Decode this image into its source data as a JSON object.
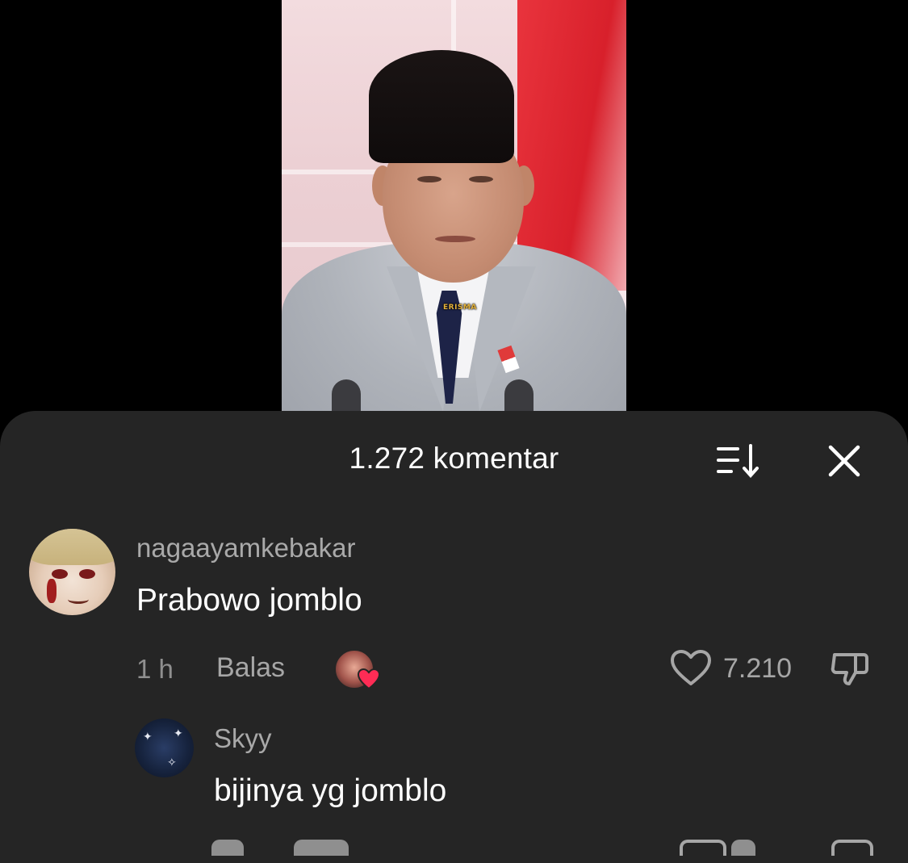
{
  "video": {
    "watermark": "ERISMA"
  },
  "sheet": {
    "title": "1.272 komentar",
    "sort_icon": "sort-descending-icon",
    "close_icon": "close-icon"
  },
  "comments": [
    {
      "username": "nagaayamkebakar",
      "text": "Prabowo jomblo",
      "time": "1 h",
      "reply_label": "Balas",
      "likes": "7.210",
      "creator_liked": true,
      "replies": [
        {
          "username": "Skyy",
          "text": "bijinya yg jomblo"
        }
      ]
    }
  ],
  "colors": {
    "sheet_bg": "#252525",
    "heart_badge": "#fe2c55",
    "muted_text": "#a6a6a6"
  }
}
